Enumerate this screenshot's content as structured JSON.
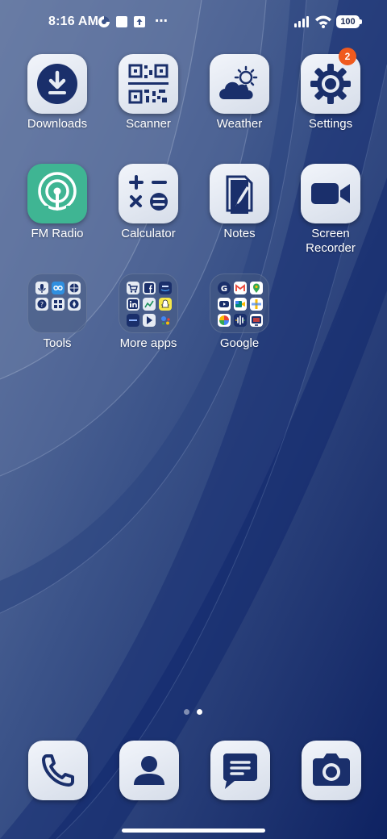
{
  "status_bar": {
    "time": "8:16 AM",
    "battery": "100",
    "overflow": "⋯",
    "icons": [
      "data-saver-icon",
      "square-notification-icon",
      "upload-notification-icon",
      "signal-icon",
      "wifi-icon",
      "battery-icon"
    ]
  },
  "apps": [
    {
      "label": "Downloads",
      "icon": "download-icon"
    },
    {
      "label": "Scanner",
      "icon": "qr-code-icon"
    },
    {
      "label": "Weather",
      "icon": "cloud-sun-icon"
    },
    {
      "label": "Settings",
      "icon": "gear-icon",
      "badge": "2"
    },
    {
      "label": "FM Radio",
      "icon": "radio-broadcast-icon"
    },
    {
      "label": "Calculator",
      "icon": "calculator-icon"
    },
    {
      "label": "Notes",
      "icon": "note-pencil-icon"
    },
    {
      "label": "Screen Recorder",
      "icon": "video-camera-icon"
    }
  ],
  "folders": [
    {
      "label": "Tools"
    },
    {
      "label": "More apps"
    },
    {
      "label": "Google"
    }
  ],
  "page_indicator": {
    "pages": 2,
    "current": 2
  },
  "dock": [
    {
      "icon": "phone-icon"
    },
    {
      "icon": "contacts-icon"
    },
    {
      "icon": "messages-icon"
    },
    {
      "icon": "camera-icon"
    }
  ],
  "colors": {
    "icon_fill": "#1a2f6b",
    "tile_bg": "#e6ebf3",
    "fm_radio_bg": "#3fb593",
    "badge": "#f05a1e"
  }
}
